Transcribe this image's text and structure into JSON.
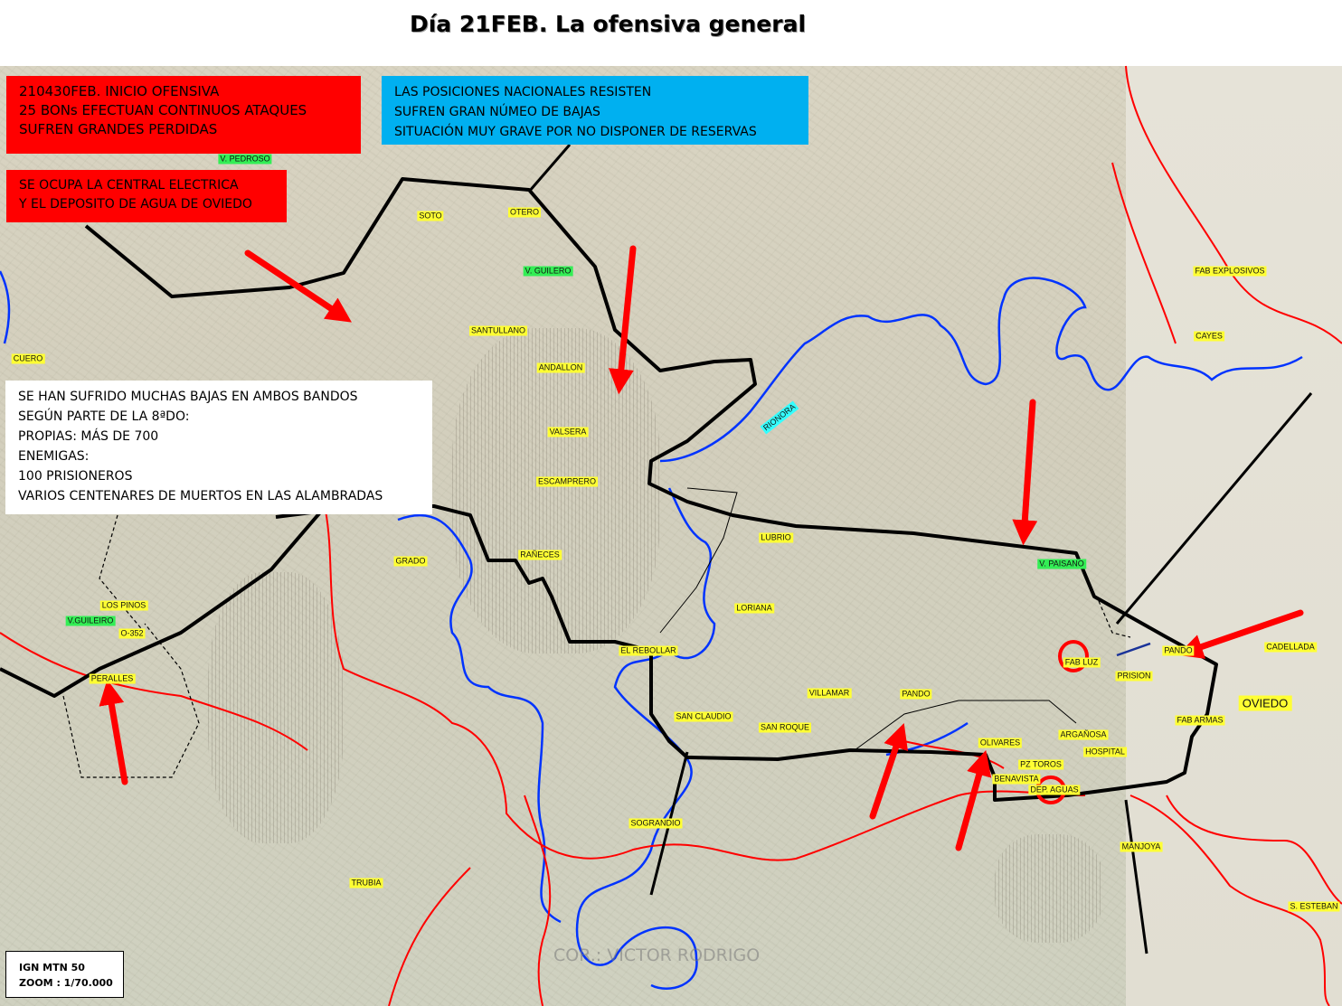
{
  "title": "Día 21FEB. La ofensiva general",
  "box_offensive": {
    "lines": [
      "210430FEB. INICIO OFENSIVA",
      "25 BONs EFECTUAN CONTINUOS ATAQUES",
      "SUFREN GRANDES  PERDIDAS"
    ],
    "color": "#ff0000"
  },
  "box_central": {
    "lines": [
      "SE OCUPA LA CENTRAL ELECTRICA",
      "Y EL DEPOSITO DE AGUA DE  OVIEDO"
    ],
    "color": "#ff0000"
  },
  "box_nacionales": {
    "lines": [
      "LAS POSICIONES NACIONALES RESISTEN",
      "SUFREN GRAN NÚMEO DE BAJAS",
      "SITUACIÓN MUY GRAVE POR NO DISPONER DE RESERVAS"
    ],
    "color": "#00b0f0"
  },
  "box_bajas": {
    "lines": [
      "SE HAN SUFRIDO MUCHAS BAJAS EN AMBOS BANDOS",
      "SEGÚN PARTE DE LA 8ªDO:",
      "PROPIAS: MÁS DE 700",
      "ENEMIGAS:",
      "100 PRISIONEROS",
      "VARIOS CENTENARES DE MUERTOS EN LAS ALAMBRADAS"
    ],
    "color": "#ffffff"
  },
  "scale": {
    "line1": "IGN MTN 50",
    "line2": "ZOOM : 1/70.000"
  },
  "watermark": "COR.: VICTOR RODRIGO",
  "place_labels": [
    {
      "name": "V. PEDROSO",
      "style": "green"
    },
    {
      "name": "SOTO",
      "style": "yellow"
    },
    {
      "name": "OTERO",
      "style": "yellow"
    },
    {
      "name": "V. GUILERO",
      "style": "green"
    },
    {
      "name": "SANTULLANO",
      "style": "yellow"
    },
    {
      "name": "ANDALLON",
      "style": "yellow"
    },
    {
      "name": "VALSERA",
      "style": "yellow"
    },
    {
      "name": "ESCAMPRERO",
      "style": "yellow"
    },
    {
      "name": "RAÑECES",
      "style": "yellow"
    },
    {
      "name": "GRADO",
      "style": "yellow"
    },
    {
      "name": "LOS PINOS",
      "style": "yellow"
    },
    {
      "name": "V.GUILEIRO",
      "style": "green"
    },
    {
      "name": "O-352",
      "style": "yellow"
    },
    {
      "name": "CUERO",
      "style": "yellow"
    },
    {
      "name": "PERALLES",
      "style": "yellow"
    },
    {
      "name": "RIONORA",
      "style": "cyan"
    },
    {
      "name": "LUBRIO",
      "style": "yellow"
    },
    {
      "name": "LORIANA",
      "style": "yellow"
    },
    {
      "name": "EL REBOLLAR",
      "style": "yellow"
    },
    {
      "name": "SAN CLAUDIO",
      "style": "yellow"
    },
    {
      "name": "VILLAMAR",
      "style": "yellow"
    },
    {
      "name": "PANDO",
      "style": "yellow"
    },
    {
      "name": "SAN ROQUE",
      "style": "yellow"
    },
    {
      "name": "OLIVARES",
      "style": "yellow"
    },
    {
      "name": "PZ TOROS",
      "style": "yellow"
    },
    {
      "name": "BENAVISTA",
      "style": "yellow"
    },
    {
      "name": "DEP. AGUAS",
      "style": "yellow"
    },
    {
      "name": "ARGAÑOSA",
      "style": "yellow"
    },
    {
      "name": "HOSPITAL",
      "style": "yellow"
    },
    {
      "name": "FAB LUZ",
      "style": "yellow"
    },
    {
      "name": "PRISION",
      "style": "yellow"
    },
    {
      "name": "V. PAISANO",
      "style": "green"
    },
    {
      "name": "FAB EXPLOSIVOS",
      "style": "yellow"
    },
    {
      "name": "CAYES",
      "style": "yellow"
    },
    {
      "name": "CADELLADA",
      "style": "yellow"
    },
    {
      "name": "PANDO",
      "style": "yellow"
    },
    {
      "name": "OVIEDO",
      "style": "yellow"
    },
    {
      "name": "FAB ARMAS",
      "style": "yellow"
    },
    {
      "name": "SOGRANDIO",
      "style": "yellow"
    },
    {
      "name": "TRUBIA",
      "style": "yellow"
    },
    {
      "name": "MANJOYA",
      "style": "yellow"
    },
    {
      "name": "S. ESTEBAN",
      "style": "yellow"
    }
  ],
  "colors": {
    "front_line": "#000000",
    "river": "#0033ff",
    "road": "#ff0000",
    "attack_arrow": "#ff0000"
  }
}
